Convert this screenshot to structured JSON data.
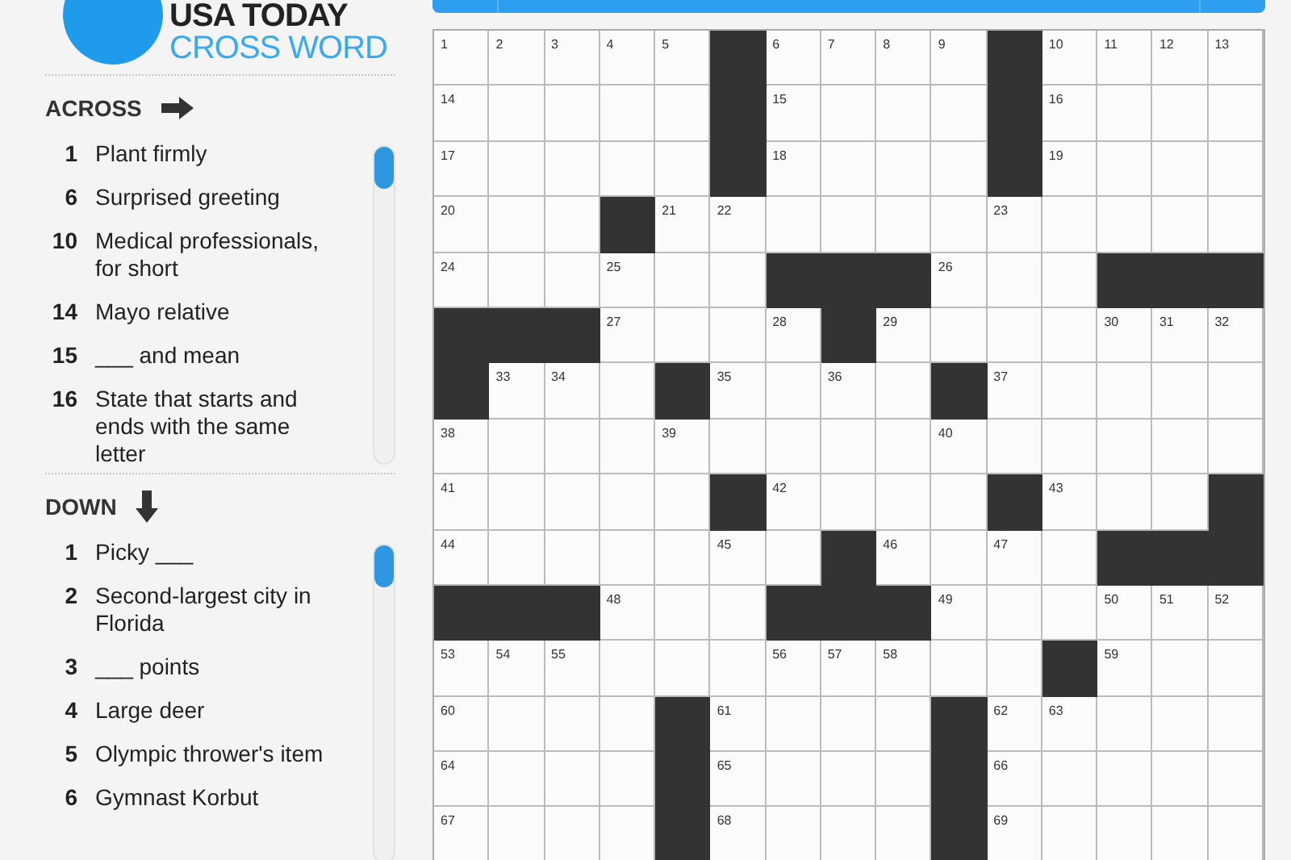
{
  "logo": {
    "line_1": "USA TODAY",
    "line_2": "CROSS WORD"
  },
  "across": {
    "heading": "ACROSS",
    "clues": [
      {
        "number": "1",
        "text": "Plant firmly"
      },
      {
        "number": "6",
        "text": "Surprised greeting"
      },
      {
        "number": "10",
        "text": "Medical professionals, for short"
      },
      {
        "number": "14",
        "text": "Mayo relative"
      },
      {
        "number": "15",
        "text": "___ and mean"
      },
      {
        "number": "16",
        "text": "State that starts and ends with the same letter"
      }
    ]
  },
  "down": {
    "heading": "DOWN",
    "clues": [
      {
        "number": "1",
        "text": "Picky ___"
      },
      {
        "number": "2",
        "text": "Second-largest city in Florida"
      },
      {
        "number": "3",
        "text": "___ points"
      },
      {
        "number": "4",
        "text": "Large deer"
      },
      {
        "number": "5",
        "text": "Olympic thrower's item"
      },
      {
        "number": "6",
        "text": "Gymnast Korbut"
      }
    ]
  },
  "grid": {
    "rows": [
      [
        {
          "kind": "square",
          "number": "1"
        },
        {
          "kind": "square",
          "number": "2"
        },
        {
          "kind": "square",
          "number": "3"
        },
        {
          "kind": "square",
          "number": "4"
        },
        {
          "kind": "square",
          "number": "5"
        },
        {
          "kind": "block"
        },
        {
          "kind": "square",
          "number": "6"
        },
        {
          "kind": "square",
          "number": "7"
        },
        {
          "kind": "square",
          "number": "8"
        },
        {
          "kind": "square",
          "number": "9"
        },
        {
          "kind": "block"
        },
        {
          "kind": "square",
          "number": "10"
        },
        {
          "kind": "square",
          "number": "11"
        },
        {
          "kind": "square",
          "number": "12"
        },
        {
          "kind": "square",
          "number": "13"
        }
      ],
      [
        {
          "kind": "square",
          "number": "14"
        },
        {
          "kind": "square"
        },
        {
          "kind": "square"
        },
        {
          "kind": "square"
        },
        {
          "kind": "square"
        },
        {
          "kind": "block"
        },
        {
          "kind": "square",
          "number": "15"
        },
        {
          "kind": "square"
        },
        {
          "kind": "square"
        },
        {
          "kind": "square"
        },
        {
          "kind": "block"
        },
        {
          "kind": "square",
          "number": "16"
        },
        {
          "kind": "square"
        },
        {
          "kind": "square"
        },
        {
          "kind": "square"
        }
      ],
      [
        {
          "kind": "square",
          "number": "17"
        },
        {
          "kind": "square"
        },
        {
          "kind": "square"
        },
        {
          "kind": "square"
        },
        {
          "kind": "square"
        },
        {
          "kind": "block"
        },
        {
          "kind": "square",
          "number": "18"
        },
        {
          "kind": "square"
        },
        {
          "kind": "square"
        },
        {
          "kind": "square"
        },
        {
          "kind": "block"
        },
        {
          "kind": "square",
          "number": "19"
        },
        {
          "kind": "square"
        },
        {
          "kind": "square"
        },
        {
          "kind": "square"
        }
      ],
      [
        {
          "kind": "square",
          "number": "20"
        },
        {
          "kind": "square"
        },
        {
          "kind": "square"
        },
        {
          "kind": "block"
        },
        {
          "kind": "square",
          "number": "21"
        },
        {
          "kind": "square",
          "number": "22"
        },
        {
          "kind": "square"
        },
        {
          "kind": "square"
        },
        {
          "kind": "square"
        },
        {
          "kind": "square"
        },
        {
          "kind": "square",
          "number": "23"
        },
        {
          "kind": "square"
        },
        {
          "kind": "square"
        },
        {
          "kind": "square"
        },
        {
          "kind": "square"
        }
      ],
      [
        {
          "kind": "square",
          "number": "24"
        },
        {
          "kind": "square"
        },
        {
          "kind": "square"
        },
        {
          "kind": "square",
          "number": "25"
        },
        {
          "kind": "square"
        },
        {
          "kind": "square"
        },
        {
          "kind": "block"
        },
        {
          "kind": "block"
        },
        {
          "kind": "block"
        },
        {
          "kind": "square",
          "number": "26"
        },
        {
          "kind": "square"
        },
        {
          "kind": "square"
        },
        {
          "kind": "block"
        },
        {
          "kind": "block"
        },
        {
          "kind": "block"
        }
      ],
      [
        {
          "kind": "block"
        },
        {
          "kind": "block"
        },
        {
          "kind": "block"
        },
        {
          "kind": "square",
          "number": "27"
        },
        {
          "kind": "square"
        },
        {
          "kind": "square"
        },
        {
          "kind": "square",
          "number": "28"
        },
        {
          "kind": "block"
        },
        {
          "kind": "square",
          "number": "29"
        },
        {
          "kind": "square"
        },
        {
          "kind": "square"
        },
        {
          "kind": "square"
        },
        {
          "kind": "square",
          "number": "30"
        },
        {
          "kind": "square",
          "number": "31"
        },
        {
          "kind": "square",
          "number": "32"
        }
      ],
      [
        {
          "kind": "block"
        },
        {
          "kind": "square",
          "number": "33"
        },
        {
          "kind": "square",
          "number": "34"
        },
        {
          "kind": "square"
        },
        {
          "kind": "block"
        },
        {
          "kind": "square",
          "number": "35"
        },
        {
          "kind": "square"
        },
        {
          "kind": "square",
          "number": "36"
        },
        {
          "kind": "square"
        },
        {
          "kind": "block"
        },
        {
          "kind": "square",
          "number": "37"
        },
        {
          "kind": "square"
        },
        {
          "kind": "square"
        },
        {
          "kind": "square"
        },
        {
          "kind": "square"
        }
      ],
      [
        {
          "kind": "square",
          "number": "38"
        },
        {
          "kind": "square"
        },
        {
          "kind": "square"
        },
        {
          "kind": "square"
        },
        {
          "kind": "square",
          "number": "39"
        },
        {
          "kind": "square"
        },
        {
          "kind": "square"
        },
        {
          "kind": "square"
        },
        {
          "kind": "square"
        },
        {
          "kind": "square",
          "number": "40"
        },
        {
          "kind": "square"
        },
        {
          "kind": "square"
        },
        {
          "kind": "square"
        },
        {
          "kind": "square"
        },
        {
          "kind": "square"
        }
      ],
      [
        {
          "kind": "square",
          "number": "41"
        },
        {
          "kind": "square"
        },
        {
          "kind": "square"
        },
        {
          "kind": "square"
        },
        {
          "kind": "square"
        },
        {
          "kind": "block"
        },
        {
          "kind": "square",
          "number": "42"
        },
        {
          "kind": "square"
        },
        {
          "kind": "square"
        },
        {
          "kind": "square"
        },
        {
          "kind": "block"
        },
        {
          "kind": "square",
          "number": "43"
        },
        {
          "kind": "square"
        },
        {
          "kind": "square"
        },
        {
          "kind": "block"
        }
      ],
      [
        {
          "kind": "square",
          "number": "44"
        },
        {
          "kind": "square"
        },
        {
          "kind": "square"
        },
        {
          "kind": "square"
        },
        {
          "kind": "square"
        },
        {
          "kind": "square",
          "number": "45"
        },
        {
          "kind": "square"
        },
        {
          "kind": "block"
        },
        {
          "kind": "square",
          "number": "46"
        },
        {
          "kind": "square"
        },
        {
          "kind": "square",
          "number": "47"
        },
        {
          "kind": "square"
        },
        {
          "kind": "block"
        },
        {
          "kind": "block"
        },
        {
          "kind": "block"
        }
      ],
      [
        {
          "kind": "block"
        },
        {
          "kind": "block"
        },
        {
          "kind": "block"
        },
        {
          "kind": "square",
          "number": "48"
        },
        {
          "kind": "square"
        },
        {
          "kind": "square"
        },
        {
          "kind": "block"
        },
        {
          "kind": "block"
        },
        {
          "kind": "block"
        },
        {
          "kind": "square",
          "number": "49"
        },
        {
          "kind": "square"
        },
        {
          "kind": "square"
        },
        {
          "kind": "square",
          "number": "50"
        },
        {
          "kind": "square",
          "number": "51"
        },
        {
          "kind": "square",
          "number": "52"
        }
      ],
      [
        {
          "kind": "square",
          "number": "53"
        },
        {
          "kind": "square",
          "number": "54"
        },
        {
          "kind": "square",
          "number": "55"
        },
        {
          "kind": "square"
        },
        {
          "kind": "square"
        },
        {
          "kind": "square"
        },
        {
          "kind": "square",
          "number": "56"
        },
        {
          "kind": "square",
          "number": "57"
        },
        {
          "kind": "square",
          "number": "58"
        },
        {
          "kind": "square"
        },
        {
          "kind": "square"
        },
        {
          "kind": "block"
        },
        {
          "kind": "square",
          "number": "59"
        },
        {
          "kind": "square"
        },
        {
          "kind": "square"
        }
      ],
      [
        {
          "kind": "square",
          "number": "60"
        },
        {
          "kind": "square"
        },
        {
          "kind": "square"
        },
        {
          "kind": "square"
        },
        {
          "kind": "block"
        },
        {
          "kind": "square",
          "number": "61"
        },
        {
          "kind": "square"
        },
        {
          "kind": "square"
        },
        {
          "kind": "square"
        },
        {
          "kind": "block"
        },
        {
          "kind": "square",
          "number": "62"
        },
        {
          "kind": "square",
          "number": "63"
        },
        {
          "kind": "square"
        },
        {
          "kind": "square"
        },
        {
          "kind": "square"
        }
      ],
      [
        {
          "kind": "square",
          "number": "64"
        },
        {
          "kind": "square"
        },
        {
          "kind": "square"
        },
        {
          "kind": "square"
        },
        {
          "kind": "block"
        },
        {
          "kind": "square",
          "number": "65"
        },
        {
          "kind": "square"
        },
        {
          "kind": "square"
        },
        {
          "kind": "square"
        },
        {
          "kind": "block"
        },
        {
          "kind": "square",
          "number": "66"
        },
        {
          "kind": "square"
        },
        {
          "kind": "square"
        },
        {
          "kind": "square"
        },
        {
          "kind": "square"
        }
      ],
      [
        {
          "kind": "square",
          "number": "67"
        },
        {
          "kind": "square"
        },
        {
          "kind": "square"
        },
        {
          "kind": "square"
        },
        {
          "kind": "block"
        },
        {
          "kind": "square",
          "number": "68"
        },
        {
          "kind": "square"
        },
        {
          "kind": "square"
        },
        {
          "kind": "square"
        },
        {
          "kind": "block"
        },
        {
          "kind": "square",
          "number": "69"
        },
        {
          "kind": "square"
        },
        {
          "kind": "square"
        },
        {
          "kind": "square"
        },
        {
          "kind": "square"
        }
      ]
    ]
  }
}
